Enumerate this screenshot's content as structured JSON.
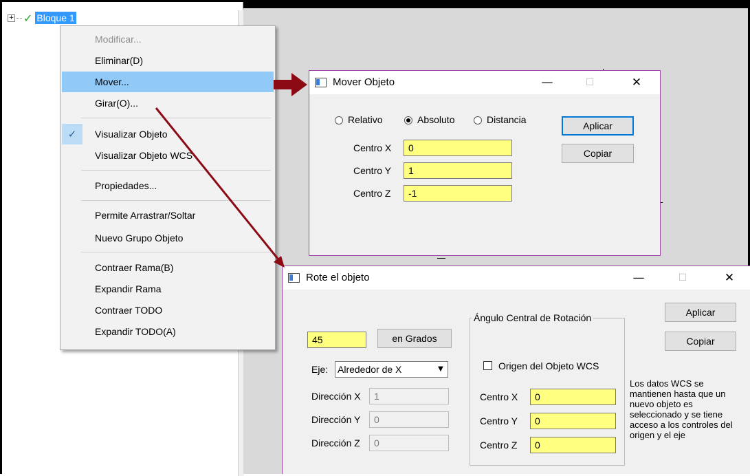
{
  "tree": {
    "expander": "+",
    "check": "✓",
    "item_label": "Bloque 1"
  },
  "context_menu": {
    "items": [
      {
        "label": "Modificar...",
        "disabled": true
      },
      {
        "label": "Eliminar(D)"
      },
      {
        "label": "Mover...",
        "highlighted": true
      },
      {
        "label": "Girar(O)..."
      },
      {
        "label": "Visualizar Objeto",
        "checked": true
      },
      {
        "label": "Visualizar Objeto WCS"
      },
      {
        "label": "Propiedades..."
      },
      {
        "label": "Permite Arrastrar/Soltar"
      },
      {
        "label": "Nuevo Grupo Objeto"
      },
      {
        "label": "Contraer Rama(B)"
      },
      {
        "label": "Expandir Rama"
      },
      {
        "label": "Contraer TODO"
      },
      {
        "label": "Expandir TODO(A)"
      }
    ],
    "check_glyph": "✓"
  },
  "mover_dialog": {
    "title": "Mover Objeto",
    "minimize": "—",
    "maximize": "☐",
    "close": "✕",
    "radio_relativo": "Relativo",
    "radio_absoluto": "Absoluto",
    "radio_distancia": "Distancia",
    "selected_mode": "Absoluto",
    "apply_label": "Aplicar",
    "copy_label": "Copiar",
    "centro_x_label": "Centro X",
    "centro_x_value": "0",
    "centro_y_label": "Centro Y",
    "centro_y_value": "1",
    "centro_z_label": "Centro Z",
    "centro_z_value": "-1"
  },
  "rotate_dialog": {
    "title": "Rote el objeto",
    "minimize": "—",
    "maximize": "☐",
    "close": "✕",
    "angle_value": "45",
    "units_button": "en Grados",
    "axis_label": "Eje:",
    "axis_value": "Alrededor de X",
    "dir_x_label": "Dirección X",
    "dir_x_value": "1",
    "dir_y_label": "Dirección Y",
    "dir_y_value": "0",
    "dir_z_label": "Dirección Z",
    "dir_z_value": "0",
    "group_title": "Ángulo Central de Rotación",
    "wcs_origin_label": "Origen del Objeto WCS",
    "centro_x_label": "Centro X",
    "centro_x_value": "0",
    "centro_y_label": "Centro Y",
    "centro_y_value": "0",
    "centro_z_label": "Centro Z",
    "centro_z_value": "0",
    "apply_label": "Aplicar",
    "copy_label": "Copiar",
    "note": "Los datos WCS se mantienen hasta que un nuevo objeto es seleccionado y se tiene acceso a los controles del origen y el eje"
  },
  "colors": {
    "arrow": "#8b0a14",
    "highlight": "#91c9f7",
    "field": "#ffff80",
    "dialog_border": "#9b4aa3"
  }
}
